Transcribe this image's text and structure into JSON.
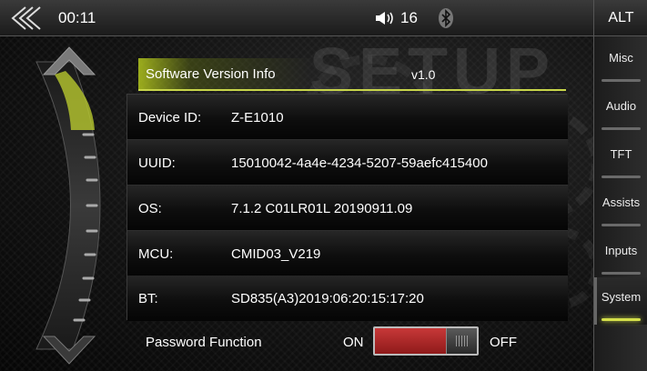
{
  "status_bar": {
    "time": "00:11",
    "volume": "16",
    "icons": [
      "back-chevrons-icon",
      "speaker-icon",
      "bluetooth-icon"
    ]
  },
  "sidebar": {
    "alt_label": "ALT",
    "items": [
      {
        "label": "Misc",
        "active": false
      },
      {
        "label": "Audio",
        "active": false
      },
      {
        "label": "TFT",
        "active": false
      },
      {
        "label": "Assists",
        "active": false
      },
      {
        "label": "Inputs",
        "active": false
      },
      {
        "label": "System",
        "active": true
      }
    ]
  },
  "watermark": "SETUP",
  "info": {
    "title": "Software Version Info",
    "version": "v1.0",
    "rows": [
      {
        "label": "Device ID:",
        "value": "Z-E1010"
      },
      {
        "label": "UUID:",
        "value": "15010042-4a4e-4234-5207-59aefc415400"
      },
      {
        "label": "OS:",
        "value": "7.1.2 C01LR01L 20190911.09"
      },
      {
        "label": "MCU:",
        "value": "CMID03_V219"
      },
      {
        "label": "BT:",
        "value": "SD835(A3)2019:06:20:15:17:20"
      }
    ]
  },
  "password": {
    "label": "Password Function",
    "on_label": "ON",
    "off_label": "OFF",
    "state": "on"
  },
  "colors": {
    "accent": "#c8d64a",
    "toggle_on": "#c73838"
  }
}
